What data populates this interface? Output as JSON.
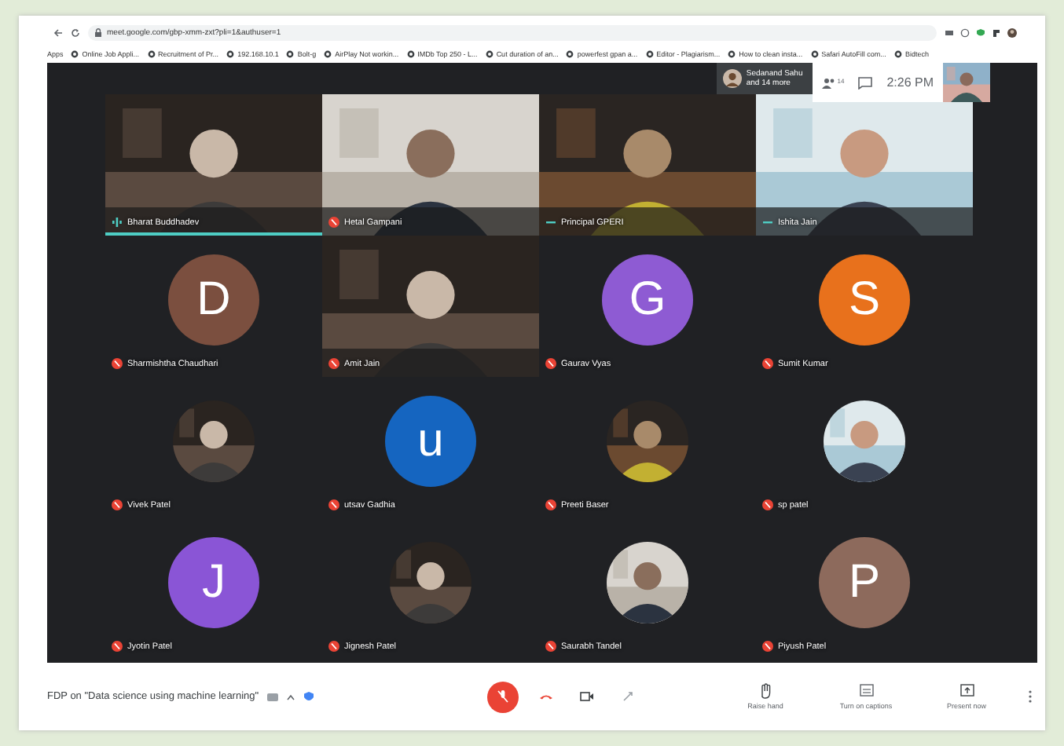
{
  "browser": {
    "url": "meet.google.com/gbp-xmm-zxt?pli=1&authuser=1",
    "bookmarks": [
      {
        "kind": "apps",
        "label": "Apps"
      },
      {
        "kind": "page",
        "label": "Online Job Appli..."
      },
      {
        "kind": "page",
        "label": "Recruitment of Pr..."
      },
      {
        "kind": "page",
        "label": "192.168.10.1"
      },
      {
        "kind": "page",
        "label": "Bolt-g"
      },
      {
        "kind": "page",
        "label": "AirPlay Not workin..."
      },
      {
        "kind": "page",
        "label": "IMDb Top 250 - L..."
      },
      {
        "kind": "page",
        "label": "Cut duration of an..."
      },
      {
        "kind": "page",
        "label": "powerfest gpan a..."
      },
      {
        "kind": "page",
        "label": "Editor - Plagiarism..."
      },
      {
        "kind": "page",
        "label": "How to clean insta..."
      },
      {
        "kind": "page",
        "label": "Safari AutoFill com..."
      },
      {
        "kind": "page",
        "label": "Bidtech"
      }
    ]
  },
  "meeting": {
    "presenter": "Sedanand Sahu",
    "presenter_more": "and 14 more",
    "people_count": "14",
    "time": "2:26 PM"
  },
  "tiles": [
    {
      "name": "Bharat Buddhadev",
      "kind": "video",
      "muted": false,
      "speaking": true
    },
    {
      "name": "Hetal Gampani",
      "kind": "video",
      "muted": true,
      "speaking": false
    },
    {
      "name": "Principal GPERI",
      "kind": "video",
      "muted": false,
      "speaking": false
    },
    {
      "name": "Ishita Jain",
      "kind": "video",
      "muted": false,
      "speaking": false
    },
    {
      "name": "Sharmishtha Chaudhari",
      "kind": "letter",
      "letter": "D",
      "color": "#7b4f3f",
      "muted": true,
      "speaking": false
    },
    {
      "name": "Amit Jain",
      "kind": "video",
      "muted": true,
      "speaking": false
    },
    {
      "name": "Gaurav Vyas",
      "kind": "letter",
      "letter": "G",
      "color": "#8e5bd3",
      "muted": true,
      "speaking": false
    },
    {
      "name": "Sumit Kumar",
      "kind": "letter",
      "letter": "S",
      "color": "#e8711c",
      "muted": true,
      "speaking": false
    },
    {
      "name": "Vivek Patel",
      "muted": true,
      "speaking": false
    },
    {
      "name": "utsav Gadhia",
      "kind": "letter",
      "letter": "u",
      "color": "#1565c0",
      "muted": true,
      "speaking": false
    },
    {
      "name": "Preeti Baser",
      "muted": true,
      "speaking": false
    },
    {
      "name": "sp patel",
      "muted": true,
      "speaking": false
    },
    {
      "name": "Jyotin Patel",
      "kind": "letter",
      "letter": "J",
      "color": "#8a55d6",
      "muted": true,
      "speaking": false
    },
    {
      "name": "Jignesh Patel",
      "muted": true,
      "speaking": false
    },
    {
      "name": "Saurabh Tandel",
      "muted": true,
      "speaking": false
    },
    {
      "name": "Piyush Patel",
      "kind": "letter",
      "letter": "P",
      "color": "#8d6a5c",
      "muted": true,
      "speaking": false
    }
  ],
  "bottom_bar": {
    "title": "FDP on \"Data science using machine learning\"",
    "mic_muted": true,
    "actions": [
      {
        "kind": "hand",
        "label": "Raise hand"
      },
      {
        "kind": "captions",
        "label": "Turn on captions"
      },
      {
        "kind": "present",
        "label": "Present now"
      }
    ]
  }
}
